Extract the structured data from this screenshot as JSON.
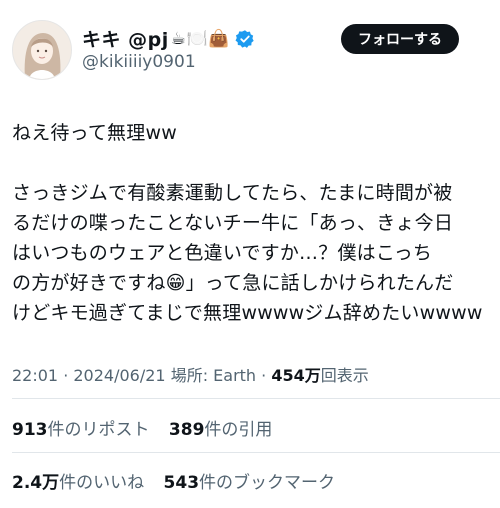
{
  "profile": {
    "display_name": "キキ @pj",
    "name_emojis": "☕🍽️👜",
    "handle": "@kikiiiiy0901",
    "verified_icon": "verified-badge-icon",
    "avatar_icon": "avatar-illustration"
  },
  "follow_button": {
    "label": "フォローする"
  },
  "post": {
    "text": "ねえ待って無理ww\n\nさっきジムで有酸素運動してたら、たまに時間が被\nるだけの喋ったことないチー牛に「あっ、きょ今日\nはいつものウェアと色違いですか…？僕はこっち\nの方が好きですね😁」って急に話しかけられたんだ\nけどキモ過ぎてまじで無理wwwwジム辞めたいwwww"
  },
  "meta": {
    "time": "22:01",
    "date": "2024/06/21",
    "location_label": "場所: Earth",
    "views_count": "454万",
    "views_label": "回表示"
  },
  "stats": {
    "reposts_count": "913",
    "reposts_label": "件のリポスト",
    "quotes_count": "389",
    "quotes_label": "件の引用",
    "likes_count": "2.4万",
    "likes_label": "件のいいね",
    "bookmarks_count": "543",
    "bookmarks_label": "件のブックマーク"
  },
  "colors": {
    "text": "#0f1419",
    "secondary": "#536471",
    "verified": "#1d9bf0",
    "button_bg": "#0f1419",
    "divider": "#e1e6ea"
  }
}
